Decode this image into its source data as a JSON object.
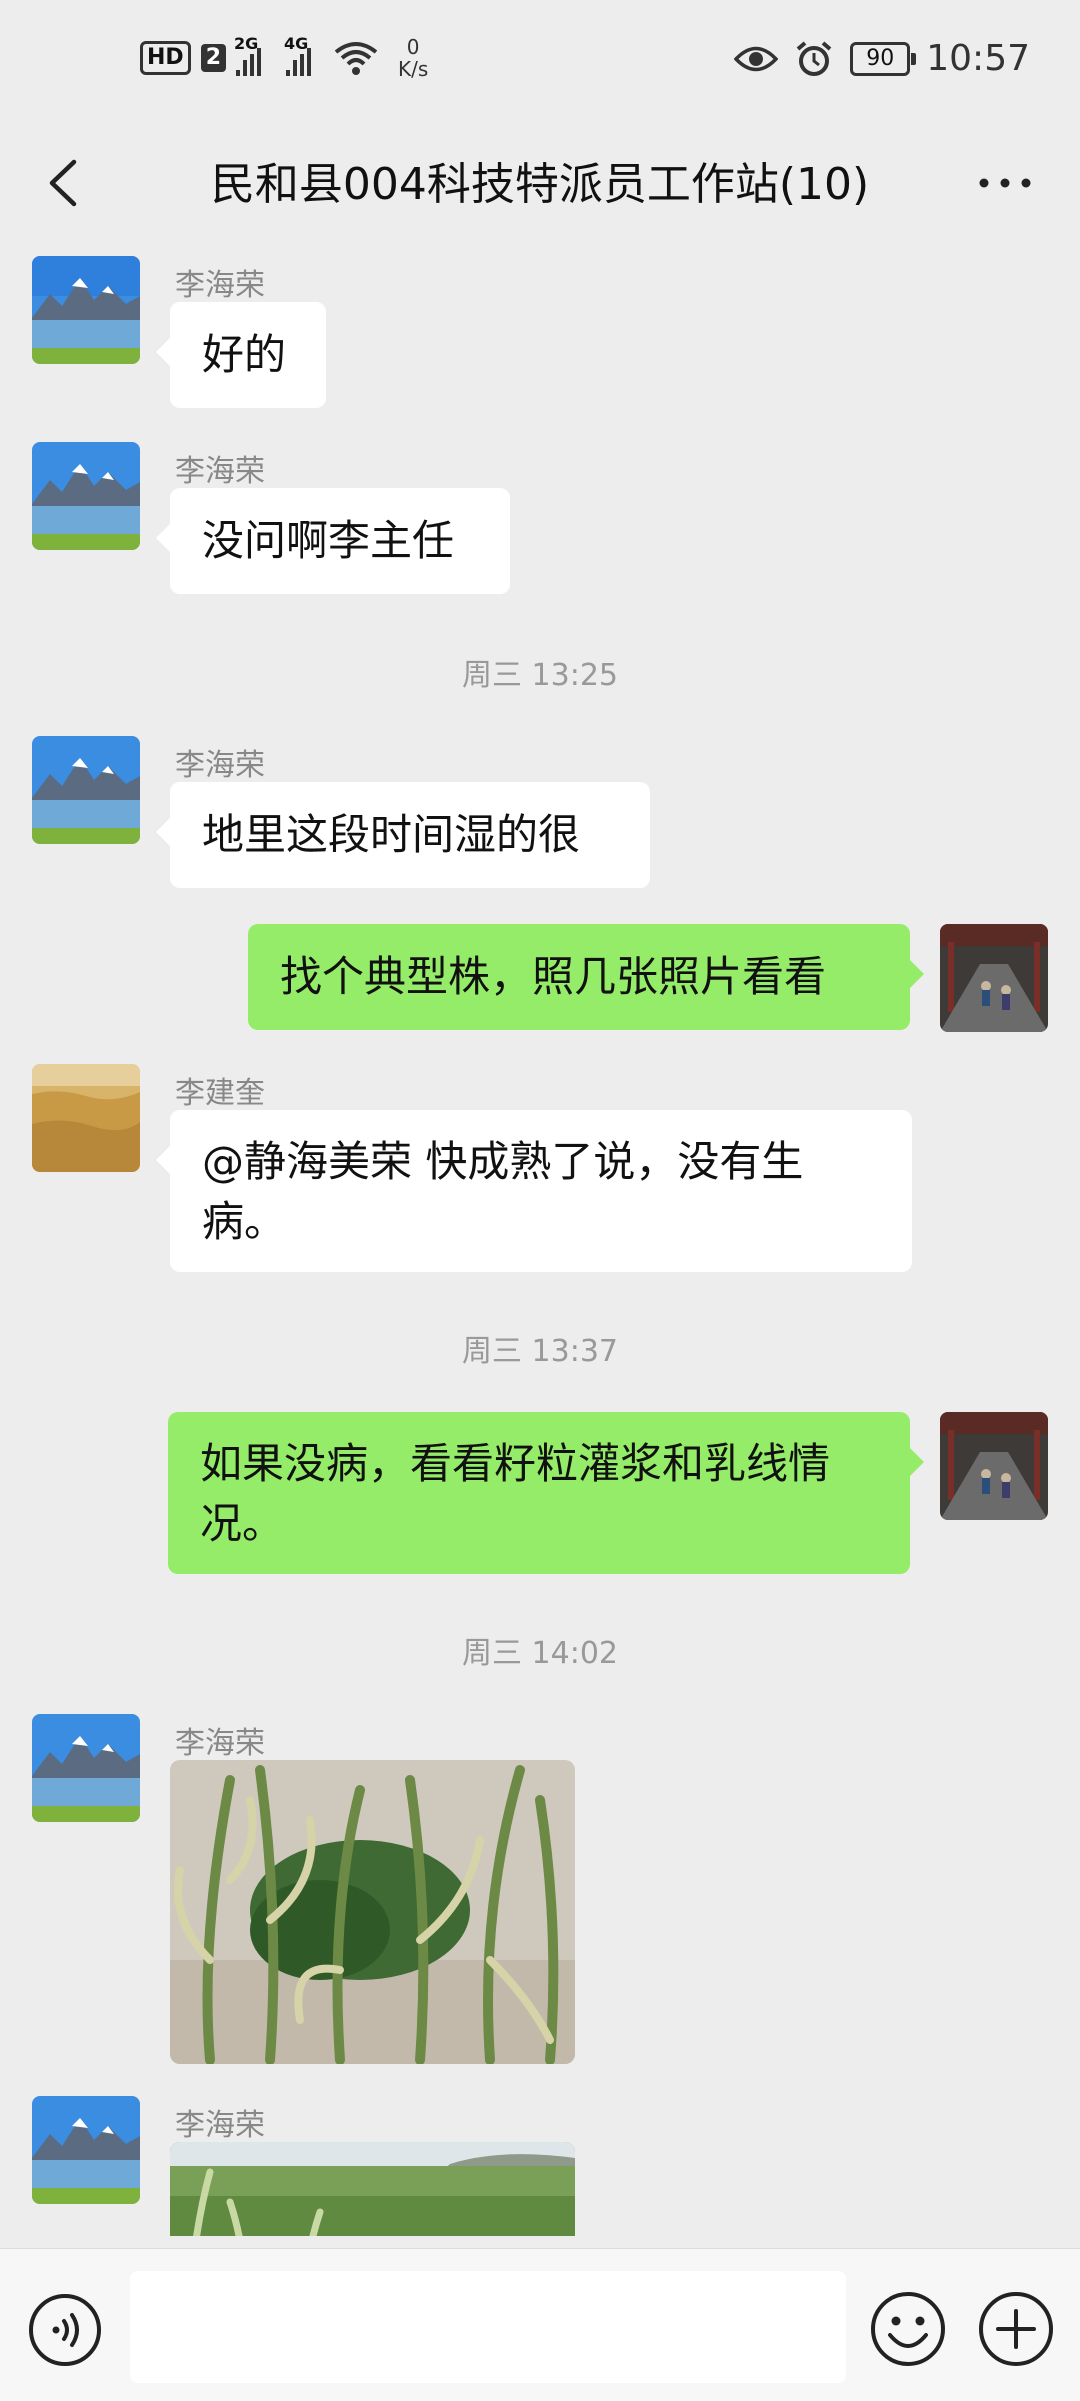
{
  "status_bar": {
    "hd_label": "HD",
    "sim_label": "2",
    "signal1_label": "2G",
    "signal2_label": "4G",
    "net_speed_value": "0",
    "net_speed_unit": "K/s",
    "battery_level": "90",
    "time": "10:57"
  },
  "header": {
    "title": "民和县004科技特派员工作站(10)"
  },
  "messages": [
    {
      "sender": "李海荣",
      "text": "好的"
    },
    {
      "sender": "李海荣",
      "text": "没问啊李主任"
    },
    {
      "timestamp": "周三 13:25"
    },
    {
      "sender": "李海荣",
      "text": "地里这段时间湿的很"
    },
    {
      "sender": "me",
      "text": "找个典型株，照几张照片看看"
    },
    {
      "sender": "李建奎",
      "text": "@静海美荣  快成熟了说，没有生病。"
    },
    {
      "timestamp": "周三 13:37"
    },
    {
      "sender": "me",
      "text": "如果没病，看看籽粒灌浆和乳线情况。"
    },
    {
      "timestamp": "周三 14:02"
    },
    {
      "sender": "李海荣",
      "image": "corn-plants-photo"
    },
    {
      "sender": "李海荣",
      "image": "corn-field-photo"
    }
  ],
  "colors": {
    "background": "#ededed",
    "my_bubble": "#95ec69",
    "other_bubble": "#ffffff"
  },
  "icons": {
    "back": "chevron-left-icon",
    "more": "more-dots-icon",
    "voice": "voice-icon",
    "emoji": "emoji-icon",
    "plus": "plus-icon"
  }
}
